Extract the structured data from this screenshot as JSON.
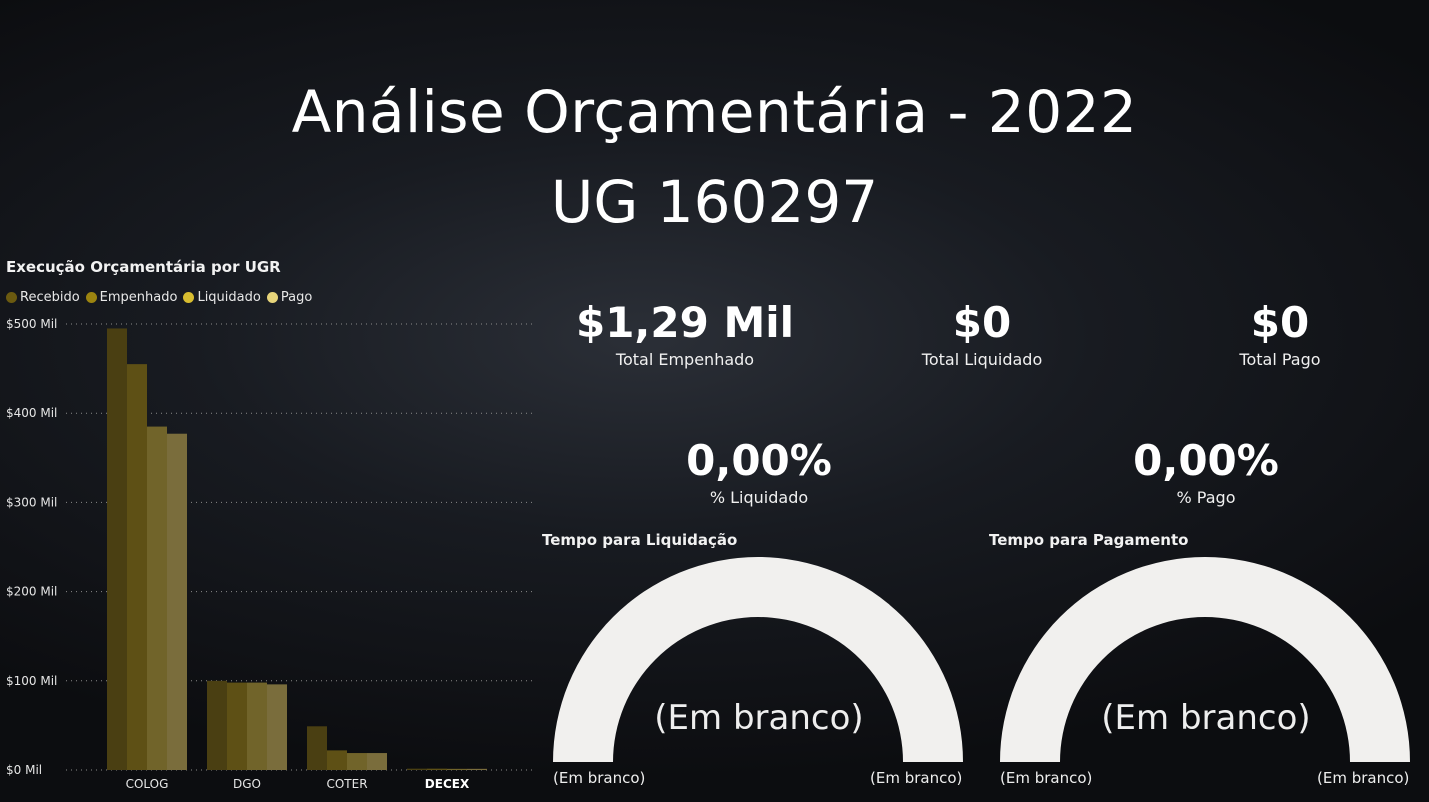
{
  "header": {
    "title_line1": "Análise Orçamentária - 2022",
    "title_line2": "UG 160297"
  },
  "chart_data": {
    "type": "bar",
    "title": "Execução Orçamentária por UGR",
    "categories": [
      "COLOG",
      "DGO",
      "COTER",
      "DECEX"
    ],
    "highlighted_category": "DECEX",
    "series": [
      {
        "name": "Recebido",
        "values": [
          495000,
          100000,
          49000,
          1500
        ],
        "color": "#4a3f12"
      },
      {
        "name": "Empenhado",
        "values": [
          455000,
          98000,
          22000,
          1500
        ],
        "color": "#5e5015"
      },
      {
        "name": "Liquidado",
        "values": [
          385000,
          98000,
          19000,
          1300
        ],
        "color": "#71642a"
      },
      {
        "name": "Pago",
        "values": [
          377000,
          96000,
          19000,
          1300
        ],
        "color": "#7a6d3c"
      }
    ],
    "legend_colors": [
      "#6b5a10",
      "#9c8410",
      "#d8bd30",
      "#e6d47a"
    ],
    "yticks": [
      "$0 Mil",
      "$100 Mil",
      "$200 Mil",
      "$300 Mil",
      "$400 Mil",
      "$500 Mil"
    ],
    "ylim": [
      0,
      500000
    ],
    "grid": true,
    "legend_position": "top-left"
  },
  "kpis": {
    "empenhado": {
      "value": "$1,29 Mil",
      "label": "Total Empenhado"
    },
    "liquidado": {
      "value": "$0",
      "label": "Total Liquidado"
    },
    "pago": {
      "value": "$0",
      "label": "Total Pago"
    },
    "pct_liquidado": {
      "value": "0,00%",
      "label": "% Liquidado"
    },
    "pct_pago": {
      "value": "0,00%",
      "label": "% Pago"
    }
  },
  "gauges": {
    "liquidacao": {
      "title": "Tempo para Liquidação",
      "center": "(Em branco)",
      "min": "(Em branco)",
      "max": "(Em branco)"
    },
    "pagamento": {
      "title": "Tempo para Pagamento",
      "center": "(Em branco)",
      "min": "(Em branco)",
      "max": "(Em branco)"
    }
  },
  "colors": {
    "gauge_fill": "#f1f0ee",
    "grid": "#8a8a8a"
  }
}
